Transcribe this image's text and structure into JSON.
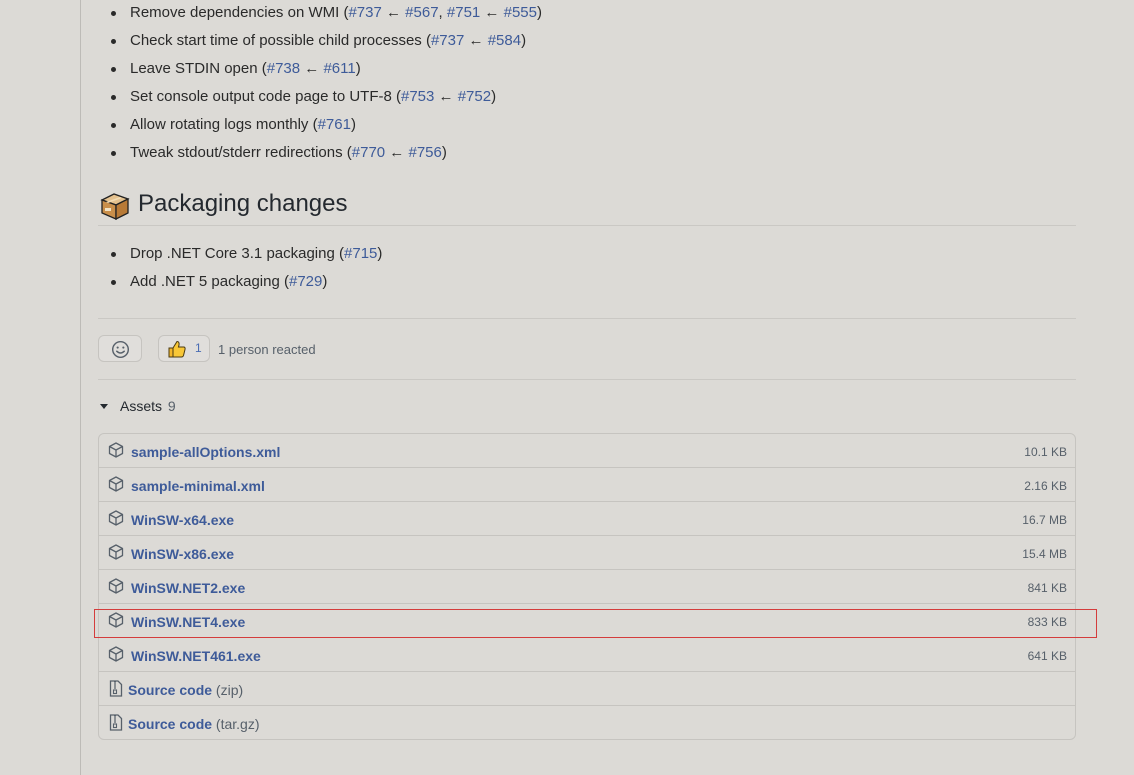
{
  "changes": [
    {
      "text": "Remove dependencies on WMI",
      "refs": [
        [
          "#737",
          "#567"
        ],
        [
          "#751",
          "#555"
        ]
      ]
    },
    {
      "text": "Check start time of possible child processes",
      "refs": [
        [
          "#737",
          "#584"
        ]
      ]
    },
    {
      "text": "Leave STDIN open",
      "refs": [
        [
          "#738",
          "#611"
        ]
      ]
    },
    {
      "text": "Set console output code page to UTF-8",
      "refs": [
        [
          "#753",
          "#752"
        ]
      ]
    },
    {
      "text": "Allow rotating logs monthly",
      "refs": [
        [
          "#761"
        ]
      ]
    },
    {
      "text": "Tweak stdout/stderr redirections",
      "refs": [
        [
          "#770",
          "#756"
        ]
      ]
    }
  ],
  "packaging": {
    "heading": "Packaging changes",
    "icon": "package-box-emoji",
    "items": [
      {
        "text": "Drop .NET Core 3.1 packaging",
        "refs": [
          [
            "#715"
          ]
        ]
      },
      {
        "text": "Add .NET 5 packaging",
        "refs": [
          [
            "#729"
          ]
        ]
      }
    ]
  },
  "reactions": {
    "add_icon": "smiley-icon",
    "thumbs_up_icon": "thumbs-up-icon",
    "thumbs_up_count": "1",
    "summary": "1 person reacted"
  },
  "assets": {
    "label": "Assets",
    "count": "9",
    "files": [
      {
        "name": "sample-allOptions.xml",
        "size": "10.1 KB"
      },
      {
        "name": "sample-minimal.xml",
        "size": "2.16 KB"
      },
      {
        "name": "WinSW-x64.exe",
        "size": "16.7 MB"
      },
      {
        "name": "WinSW-x86.exe",
        "size": "15.4 MB"
      },
      {
        "name": "WinSW.NET2.exe",
        "size": "841 KB"
      },
      {
        "name": "WinSW.NET4.exe",
        "size": "833 KB"
      },
      {
        "name": "WinSW.NET461.exe",
        "size": "641 KB"
      }
    ],
    "source": [
      {
        "name": "Source code",
        "ext": "(zip)"
      },
      {
        "name": "Source code",
        "ext": "(tar.gz)"
      }
    ]
  },
  "colors": {
    "link": "#3e5b99",
    "highlight_border": "#d43c3c",
    "background": "#dcdad6"
  }
}
